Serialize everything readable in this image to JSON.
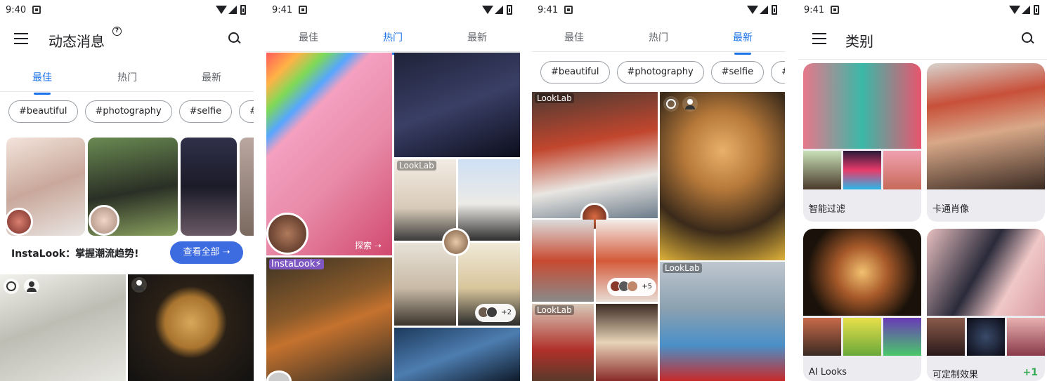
{
  "status": {
    "time1": "9:40",
    "time2": "9:41",
    "time3": "9:41",
    "time4": "9:41"
  },
  "feed": {
    "title": "动态消息",
    "help_symbol": "?"
  },
  "tabs": {
    "best": "最佳",
    "hot": "热门",
    "newest": "最新"
  },
  "chips": [
    "#beautiful",
    "#photography",
    "#selfie",
    "#"
  ],
  "promo": {
    "text": "InstaLook：掌握潮流趋势!",
    "button": "查看全部 ➝"
  },
  "hot": {
    "explore": "探索 ➝",
    "badge_lookl": "LookLab",
    "badge_insta": "InstaLook⚡",
    "more_count": "+2"
  },
  "newest": {
    "badge_a": "LookLab",
    "badge_b": "LookLab",
    "badge_c": "LookLab",
    "more_count": "+5"
  },
  "categories": {
    "title": "类别",
    "items": [
      {
        "label": "智能过滤"
      },
      {
        "label": "卡通肖像"
      },
      {
        "label": "AI Looks"
      },
      {
        "label": "可定制效果",
        "extra": "+1"
      }
    ]
  },
  "colors": {
    "accent": "#1a73e8",
    "button": "#3d6be0",
    "plus": "#34a853"
  }
}
